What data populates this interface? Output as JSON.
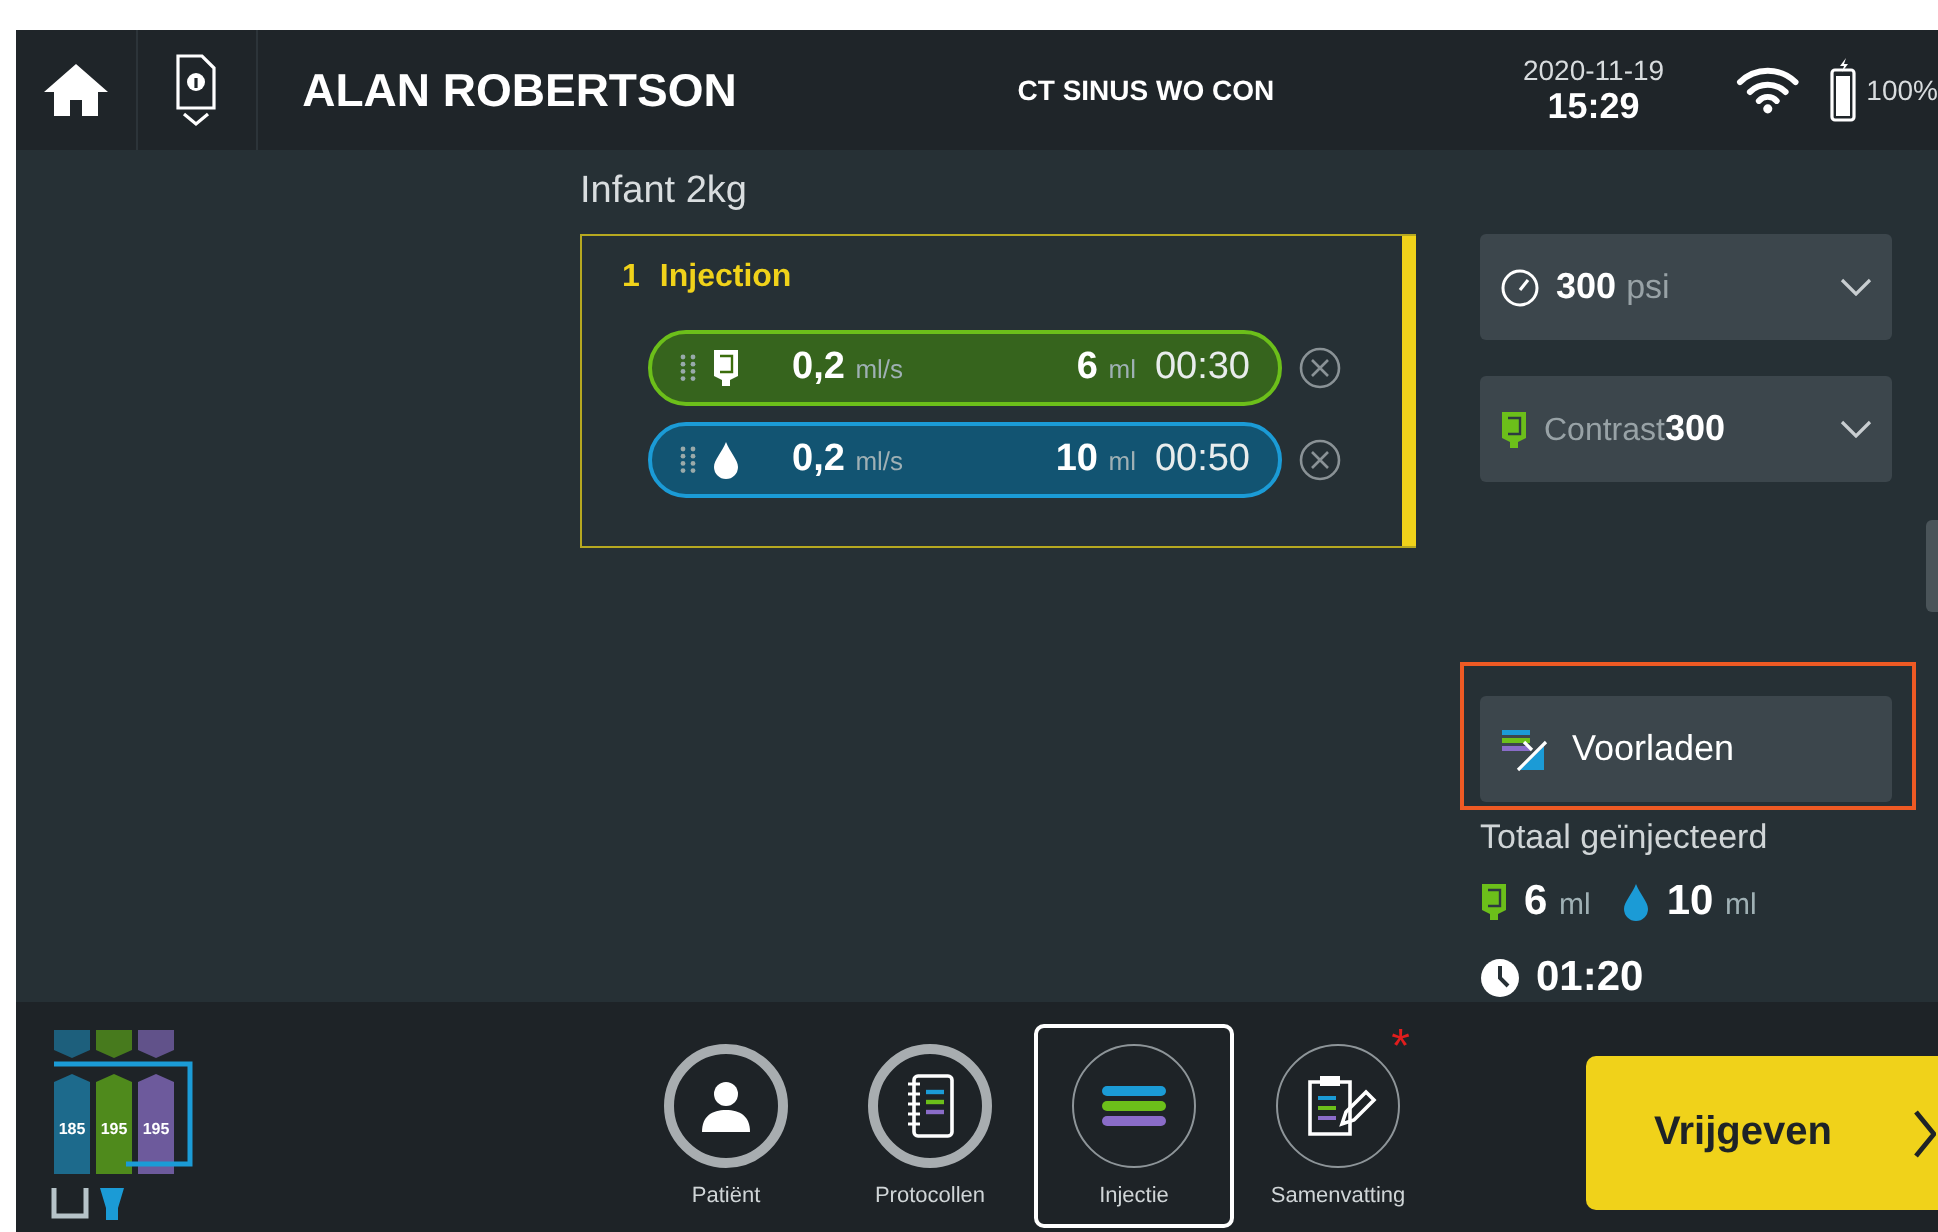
{
  "header": {
    "patient_name": "ALAN ROBERTSON",
    "protocol": "CT SINUS WO CON",
    "date": "2020-11-19",
    "time": "15:29",
    "battery": "100%"
  },
  "protocol_title": "Infant 2kg",
  "phase": {
    "number": "1",
    "title": "Injection",
    "steps": [
      {
        "kind": "contrast",
        "color": "#6cbf1a",
        "flow": "0,2",
        "flow_unit": "ml/s",
        "volume": "6",
        "volume_unit": "ml",
        "duration": "00:30"
      },
      {
        "kind": "saline",
        "color": "#1b9bd6",
        "flow": "0,2",
        "flow_unit": "ml/s",
        "volume": "10",
        "volume_unit": "ml",
        "duration": "00:50"
      }
    ]
  },
  "pressure": {
    "value": "300",
    "unit": "psi"
  },
  "contrast": {
    "label": "Contrast",
    "value": "300"
  },
  "preload_button": {
    "label": "Voorladen",
    "highlighted": true
  },
  "totals": {
    "title": "Totaal geïnjecteerd",
    "contrast_volume": "6",
    "contrast_unit": "ml",
    "saline_volume": "10",
    "saline_unit": "ml",
    "time": "01:20"
  },
  "syringes": [
    {
      "label": "185",
      "color": "#1d6a8c"
    },
    {
      "label": "195",
      "color": "#4f8a1c"
    },
    {
      "label": "195",
      "color": "#6d5a9c"
    }
  ],
  "nav": [
    {
      "kind": "patient",
      "label": "Patiënt",
      "selected": false,
      "completed": true
    },
    {
      "kind": "protocols",
      "label": "Protocollen",
      "selected": false,
      "completed": true
    },
    {
      "kind": "injection",
      "label": "Injectie",
      "selected": true,
      "completed": false
    },
    {
      "kind": "summary",
      "label": "Samenvatting",
      "selected": false,
      "completed": false,
      "alert_mark": "*"
    }
  ],
  "release_button": {
    "label": "Vrijgeven"
  }
}
